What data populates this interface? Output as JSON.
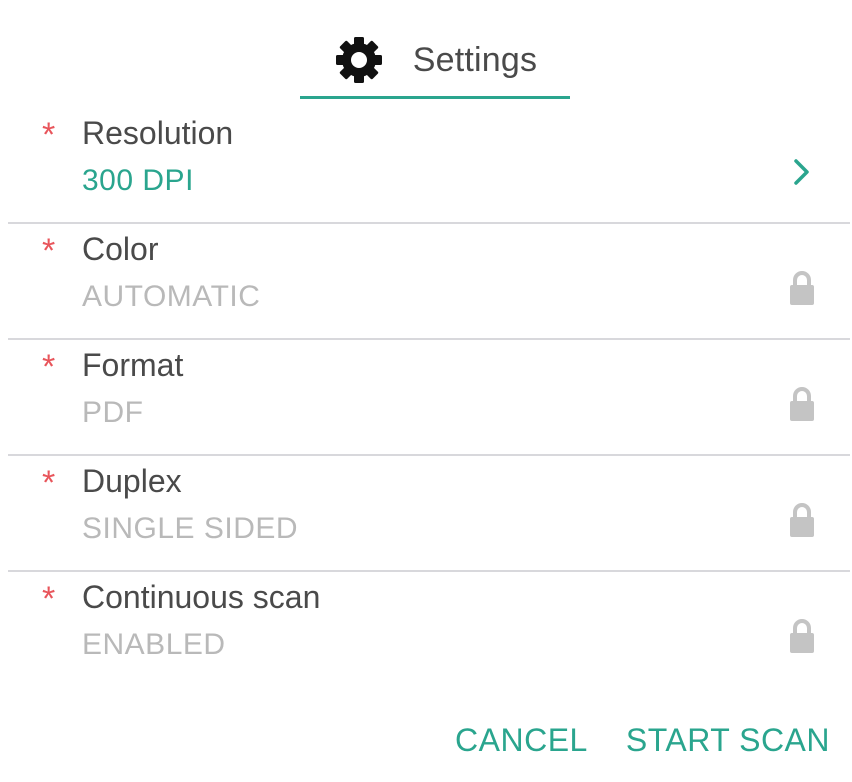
{
  "header": {
    "title": "Settings",
    "icon": "gear-icon",
    "accent_color": "#2aa58e"
  },
  "settings": [
    {
      "label": "Resolution",
      "value": "300 DPI",
      "required": "*",
      "trailing_icon": "chevron-right-icon",
      "editable": true
    },
    {
      "label": "Color",
      "value": "AUTOMATIC",
      "required": "*",
      "trailing_icon": "lock-icon",
      "editable": false
    },
    {
      "label": "Format",
      "value": "PDF",
      "required": "*",
      "trailing_icon": "lock-icon",
      "editable": false
    },
    {
      "label": "Duplex",
      "value": "SINGLE SIDED",
      "required": "*",
      "trailing_icon": "lock-icon",
      "editable": false
    },
    {
      "label": "Continuous scan",
      "value": "ENABLED",
      "required": "*",
      "trailing_icon": "lock-icon",
      "editable": false
    }
  ],
  "actions": {
    "cancel": "CANCEL",
    "start_scan": "START SCAN"
  },
  "colors": {
    "accent": "#2aa58e",
    "required_marker": "#e8555b",
    "disabled_text": "#b9b9b9",
    "label_text": "#4a4a4a"
  }
}
